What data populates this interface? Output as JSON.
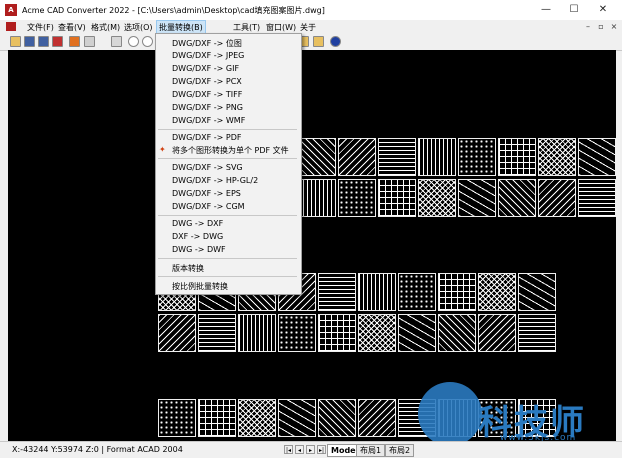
{
  "window": {
    "title": "Acme CAD Converter 2022 - [C:\\Users\\admin\\Desktop\\cad填充图案图片.dwg]",
    "minimize": "—",
    "maximize": "☐",
    "close": "✕"
  },
  "menubar": {
    "items": [
      "文件(F)",
      "查看(V)",
      "格式(M)",
      "选项(O)",
      "批量转换(B)",
      "工具(T)",
      "窗口(W)",
      "关于"
    ],
    "active": "批量转换(B)"
  },
  "batch_menu": {
    "group1": [
      "DWG/DXF -> 位图",
      "DWG/DXF -> JPEG",
      "DWG/DXF -> GIF",
      "DWG/DXF -> PCX",
      "DWG/DXF -> TIFF",
      "DWG/DXF -> PNG",
      "DWG/DXF -> WMF"
    ],
    "group2": [
      "DWG/DXF -> PDF",
      "将多个图形转换为单个 PDF 文件"
    ],
    "group3": [
      "DWG/DXF -> SVG",
      "DWG/DXF -> HP-GL/2",
      "DWG/DXF -> EPS",
      "DWG/DXF -> CGM"
    ],
    "group4": [
      "DWG -> DXF",
      "DXF -> DWG",
      "DWG -> DWF"
    ],
    "group5": [
      "版本转换"
    ],
    "group6": [
      "按比例批量转换"
    ]
  },
  "status": {
    "coords": "X:-43244 Y:53974 Z:0 | Format ACAD 2004"
  },
  "layout_tabs": [
    "Model",
    "布局1",
    "布局2"
  ],
  "active_tab": "Model",
  "watermark": {
    "text": "科技师",
    "url": "www.3kjs.com"
  },
  "colors": {
    "canvas": "#000000",
    "menu_highlight": "#cce4f7",
    "watermark": "#2a7ac0"
  }
}
